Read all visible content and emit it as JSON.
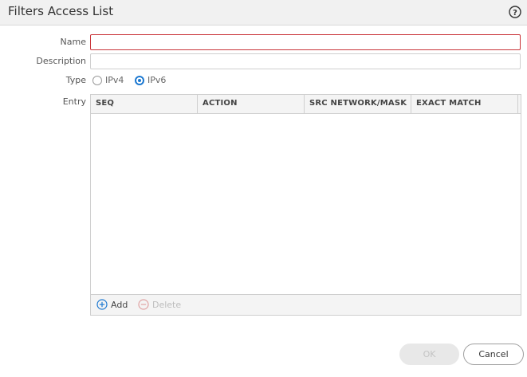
{
  "dialog": {
    "title": "Filters Access List",
    "help_icon": "question-circle-icon"
  },
  "form": {
    "name_label": "Name",
    "name_value": "",
    "description_label": "Description",
    "description_value": "",
    "type_label": "Type",
    "type_options": [
      "IPv4",
      "IPv6"
    ],
    "type_selected": "IPv6",
    "entry_label": "Entry"
  },
  "entry_table": {
    "columns": [
      "SEQ",
      "ACTION",
      "SRC NETWORK/MASK",
      "EXACT MATCH"
    ],
    "rows": [],
    "add_label": "Add",
    "delete_label": "Delete",
    "add_icon": "plus-circle-icon",
    "delete_icon": "minus-circle-icon"
  },
  "buttons": {
    "ok_label": "OK",
    "cancel_label": "Cancel"
  },
  "colors": {
    "accent": "#1d79d1",
    "invalid_border": "#c9353a",
    "disabled_text": "#c4c4c4"
  }
}
